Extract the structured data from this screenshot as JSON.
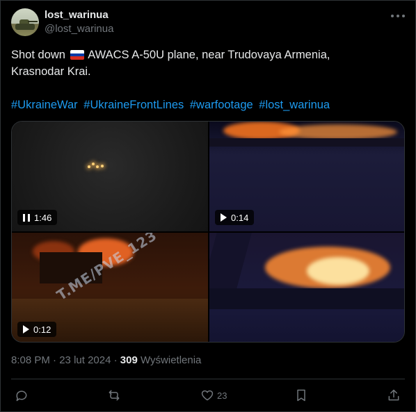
{
  "user": {
    "name": "lost_warinua",
    "handle": "@lost_warinua"
  },
  "tweet": {
    "text_before_flag": "Shot down",
    "text_after_flag": "AWACS A-50U plane, near Trudovaya Armenia,",
    "text_line2": "Krasnodar Krai.",
    "hashtags": [
      "#UkraineWar",
      "#UkraineFrontLines",
      "#warfootage",
      "#lost_warinua"
    ]
  },
  "media": [
    {
      "duration": "1:46",
      "state": "playing"
    },
    {
      "duration": "0:14",
      "state": "paused"
    },
    {
      "duration": "0:12",
      "state": "paused",
      "watermark": "T.ME/PVE_123"
    },
    {
      "duration": ""
    }
  ],
  "meta": {
    "time": "8:08 PM",
    "separator": "·",
    "date": "23 lut 2024",
    "views_count": "309",
    "views_label": "Wyświetlenia"
  },
  "actions": {
    "reply_count": "",
    "repost_count": "",
    "like_count": "23"
  },
  "colors": {
    "background": "#000000",
    "text": "#e7e9ea",
    "secondary": "#71767b",
    "link": "#1d9bf0",
    "border": "#2f3336"
  },
  "icons": [
    "more-icon",
    "reply-icon",
    "repost-icon",
    "like-icon",
    "bookmark-icon",
    "share-icon",
    "pause-icon",
    "play-icon",
    "russia-flag-icon"
  ]
}
